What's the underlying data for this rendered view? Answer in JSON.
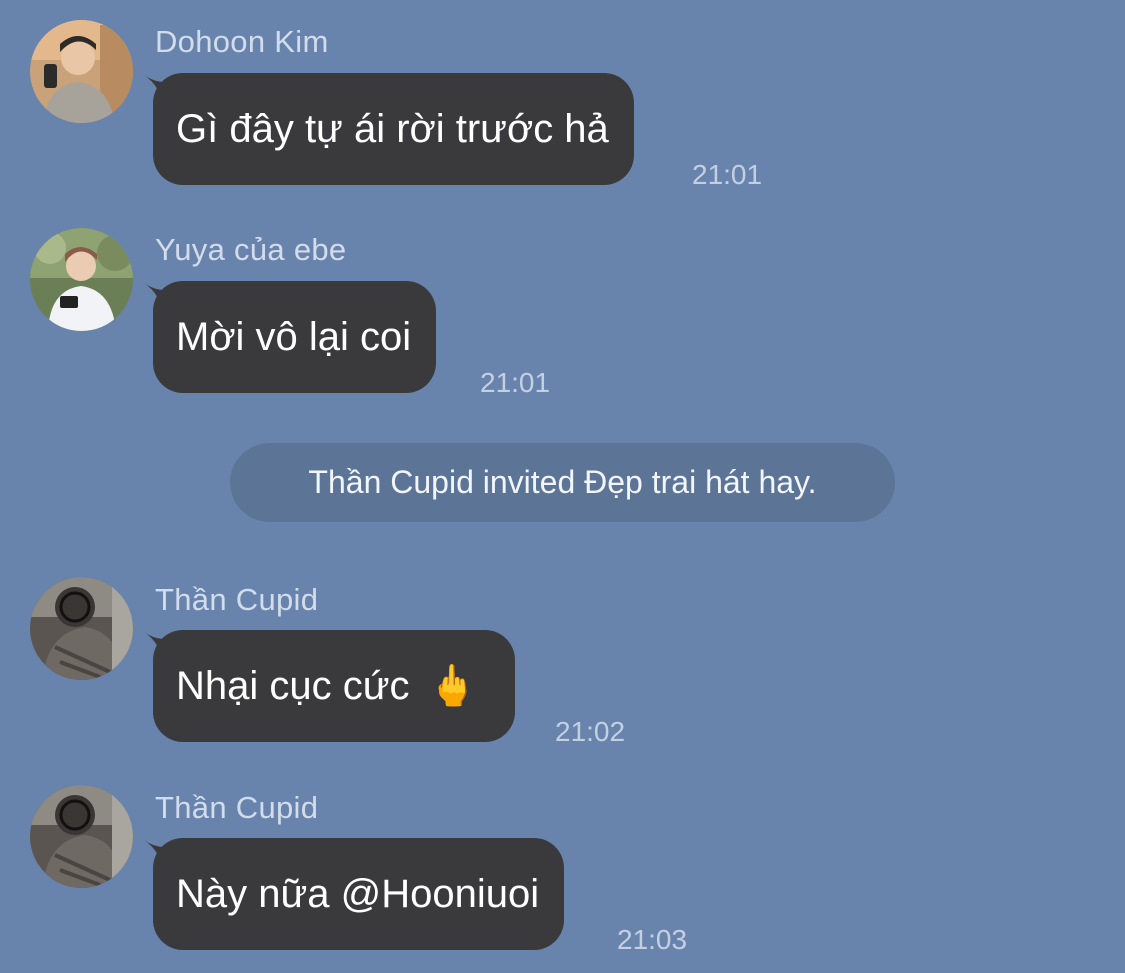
{
  "messages": [
    {
      "sender": "Dohoon Kim",
      "text": "Gì đây tự ái rời trước hả",
      "time": "21:01",
      "avatar_icon": "user-avatar-dohoon"
    },
    {
      "sender": "Yuya của ebe",
      "text": "Mời vô lại coi",
      "time": "21:01",
      "avatar_icon": "user-avatar-yuya"
    },
    {
      "sender": "Thần Cupid",
      "text": "Nhại cục cức",
      "emoji": "🖕",
      "time": "21:02",
      "avatar_icon": "user-avatar-cupid"
    },
    {
      "sender": "Thần Cupid",
      "text": "Này nữa @Hooniuoi",
      "time": "21:03",
      "avatar_icon": "user-avatar-cupid"
    }
  ],
  "system_notice": "Thần Cupid invited Đẹp trai hát hay.",
  "colors": {
    "background": "#6884AD",
    "bubble": "#3A3A3C",
    "bubble_text": "#FFFFFF",
    "sender_name": "#D2DCEB",
    "timestamp": "#C4D0E2",
    "system_pill": "#5C7596"
  }
}
